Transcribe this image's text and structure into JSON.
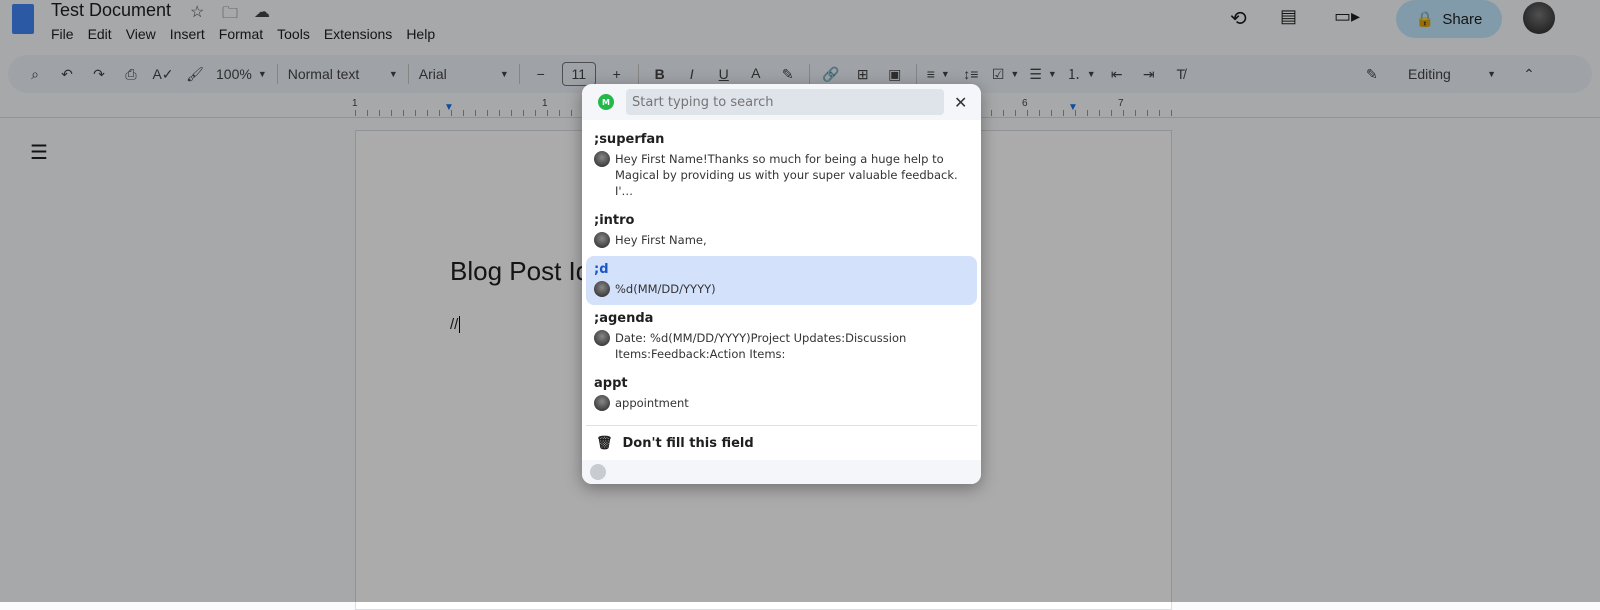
{
  "app": {
    "title": "Test Document",
    "menu": [
      "File",
      "Edit",
      "View",
      "Insert",
      "Format",
      "Tools",
      "Extensions",
      "Help"
    ],
    "share_label": "Share"
  },
  "toolbar": {
    "zoom": "100%",
    "style": "Normal text",
    "font": "Arial",
    "font_size": "11",
    "mode": "Editing"
  },
  "ruler": {
    "labels": [
      "1",
      "1",
      "6",
      "7"
    ]
  },
  "document": {
    "heading": "Blog Post Id",
    "line": "//"
  },
  "popup": {
    "search_placeholder": "Start typing to search",
    "items": [
      {
        "key": ";superfan",
        "text": "Hey First Name!Thanks so much for being a huge help to Magical by providing us with your super valuable feedback. I'…"
      },
      {
        "key": ";intro",
        "text": "Hey First Name,"
      },
      {
        "key": ";d",
        "text": "%d(MM/DD/YYYY)",
        "selected": true
      },
      {
        "key": ";agenda",
        "text": "Date: %d(MM/DD/YYYY)Project Updates:Discussion Items:Feedback:Action Items:"
      },
      {
        "key": "appt",
        "text": "appointment"
      }
    ],
    "dont_fill": "Don't fill this field",
    "logo_text": "M"
  },
  "colors": {
    "accent": "#1a56c4",
    "selected_bg": "#d3e1fb",
    "logo": "#22b84a",
    "share_bg": "#c2e7ff"
  }
}
